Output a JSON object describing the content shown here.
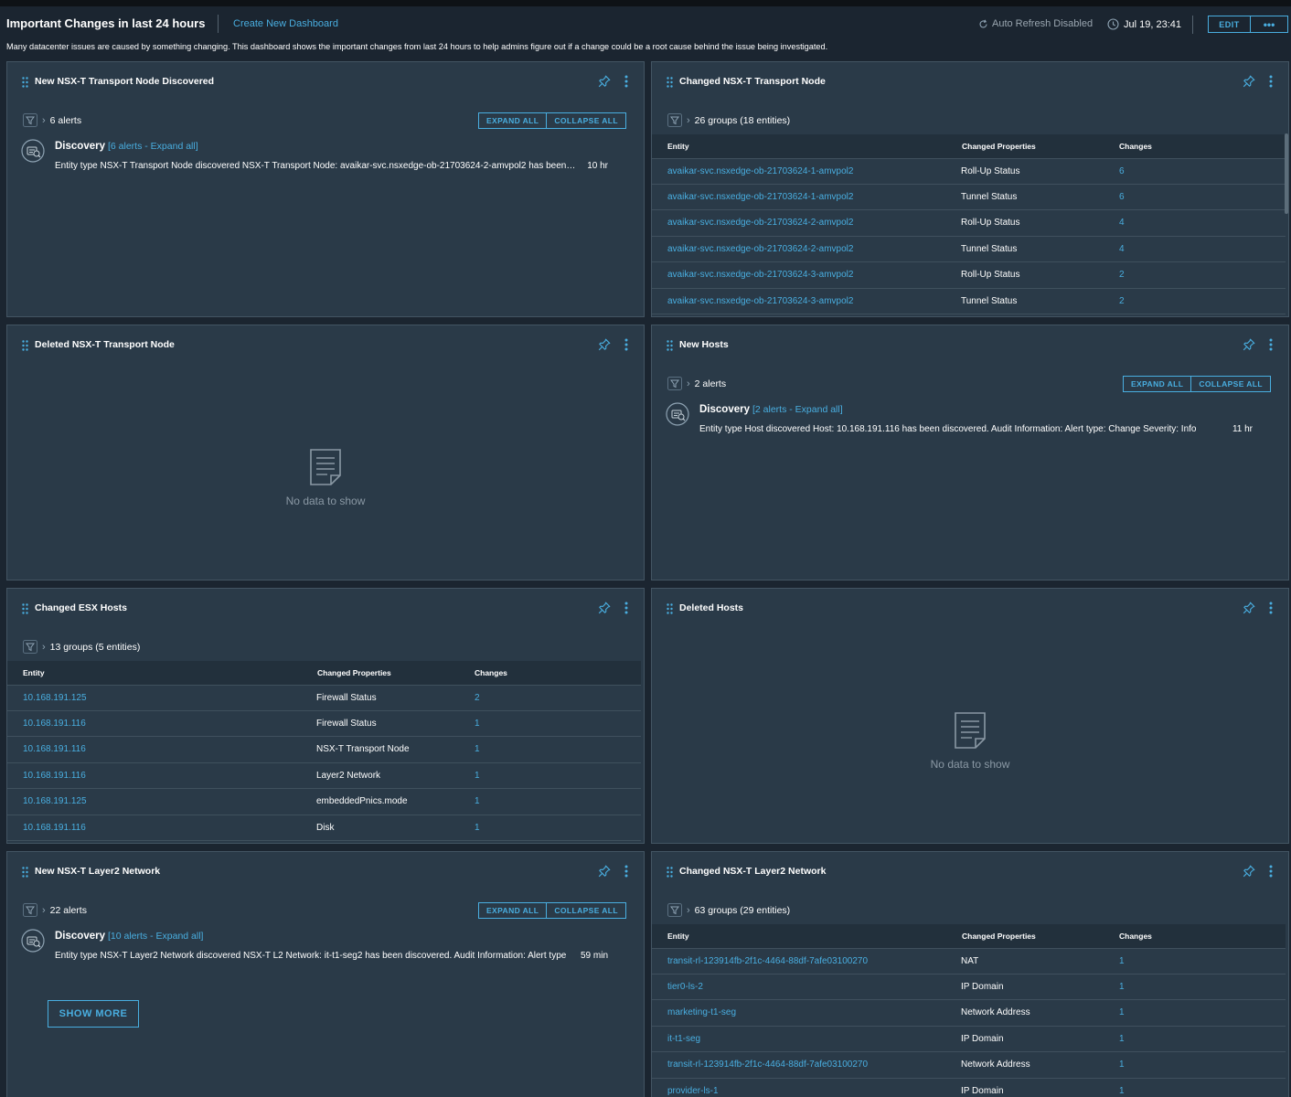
{
  "header": {
    "title": "Important Changes in last 24 hours",
    "create_link": "Create New Dashboard",
    "auto_refresh": "Auto Refresh Disabled",
    "date": "Jul 19, 23:41",
    "edit_label": "EDIT",
    "more_label": "•••",
    "description": "Many datacenter issues are caused by something changing. This dashboard shows the important changes from last 24 hours to help admins figure out if a change could be a root cause behind the issue being investigated."
  },
  "labels": {
    "expand_all": "EXPAND ALL",
    "collapse_all": "COLLAPSE ALL",
    "show_more": "SHOW MORE",
    "no_data": "No data to show",
    "col_entity": "Entity",
    "col_changed_props": "Changed Properties",
    "col_changes": "Changes"
  },
  "widgets": {
    "new_tn": {
      "title": "New NSX-T Transport Node Discovered",
      "alerts_count": "6 alerts",
      "alert_title": "Discovery",
      "alert_count_link": "[6 alerts - Expand all]",
      "alert_desc": "Entity type NSX-T Transport Node discovered NSX-T Transport Node: avaikar-svc.nsxedge-ob-21703624-2-amvpol2 has been discovered.",
      "alert_time": "10 hr"
    },
    "changed_tn": {
      "title": "Changed NSX-T Transport Node",
      "groups": "26 groups (18 entities)",
      "rows": [
        {
          "entity": "avaikar-svc.nsxedge-ob-21703624-1-amvpol2",
          "prop": "Roll-Up Status",
          "changes": "6"
        },
        {
          "entity": "avaikar-svc.nsxedge-ob-21703624-1-amvpol2",
          "prop": "Tunnel Status",
          "changes": "6"
        },
        {
          "entity": "avaikar-svc.nsxedge-ob-21703624-2-amvpol2",
          "prop": "Roll-Up Status",
          "changes": "4"
        },
        {
          "entity": "avaikar-svc.nsxedge-ob-21703624-2-amvpol2",
          "prop": "Tunnel Status",
          "changes": "4"
        },
        {
          "entity": "avaikar-svc.nsxedge-ob-21703624-3-amvpol2",
          "prop": "Roll-Up Status",
          "changes": "2"
        },
        {
          "entity": "avaikar-svc.nsxedge-ob-21703624-3-amvpol2",
          "prop": "Tunnel Status",
          "changes": "2"
        }
      ]
    },
    "deleted_tn": {
      "title": "Deleted NSX-T Transport Node"
    },
    "new_hosts": {
      "title": "New Hosts",
      "alerts_count": "2 alerts",
      "alert_title": "Discovery",
      "alert_count_link": "[2 alerts - Expand all]",
      "alert_desc": "Entity type Host discovered Host: 10.168.191.116 has been discovered. Audit Information: Alert type: Change Severity: Info",
      "alert_time": "11 hr"
    },
    "changed_esx": {
      "title": "Changed ESX Hosts",
      "groups": "13 groups (5 entities)",
      "rows": [
        {
          "entity": "10.168.191.125",
          "prop": "Firewall Status",
          "changes": "2"
        },
        {
          "entity": "10.168.191.116",
          "prop": "Firewall Status",
          "changes": "1"
        },
        {
          "entity": "10.168.191.116",
          "prop": "NSX-T Transport Node",
          "changes": "1"
        },
        {
          "entity": "10.168.191.116",
          "prop": "Layer2 Network",
          "changes": "1"
        },
        {
          "entity": "10.168.191.125",
          "prop": "embeddedPnics.mode",
          "changes": "1"
        },
        {
          "entity": "10.168.191.116",
          "prop": "Disk",
          "changes": "1"
        }
      ]
    },
    "deleted_hosts": {
      "title": "Deleted Hosts"
    },
    "new_l2": {
      "title": "New NSX-T Layer2 Network",
      "alerts_count": "22 alerts",
      "alert_title": "Discovery",
      "alert_count_link": "[10 alerts - Expand all]",
      "alert_desc": "Entity type NSX-T Layer2 Network discovered NSX-T L2 Network: it-t1-seg2 has been discovered. Audit Information: Alert type",
      "alert_time": "59 min"
    },
    "changed_l2": {
      "title": "Changed NSX-T Layer2 Network",
      "groups": "63 groups (29 entities)",
      "rows": [
        {
          "entity": "transit-rl-123914fb-2f1c-4464-88df-7afe03100270",
          "prop": "NAT",
          "changes": "1"
        },
        {
          "entity": "tier0-ls-2",
          "prop": "IP Domain",
          "changes": "1"
        },
        {
          "entity": "marketing-t1-seg",
          "prop": "Network Address",
          "changes": "1"
        },
        {
          "entity": "it-t1-seg",
          "prop": "IP Domain",
          "changes": "1"
        },
        {
          "entity": "transit-rl-123914fb-2f1c-4464-88df-7afe03100270",
          "prop": "Network Address",
          "changes": "1"
        },
        {
          "entity": "provider-ls-1",
          "prop": "IP Domain",
          "changes": "1"
        }
      ]
    }
  }
}
